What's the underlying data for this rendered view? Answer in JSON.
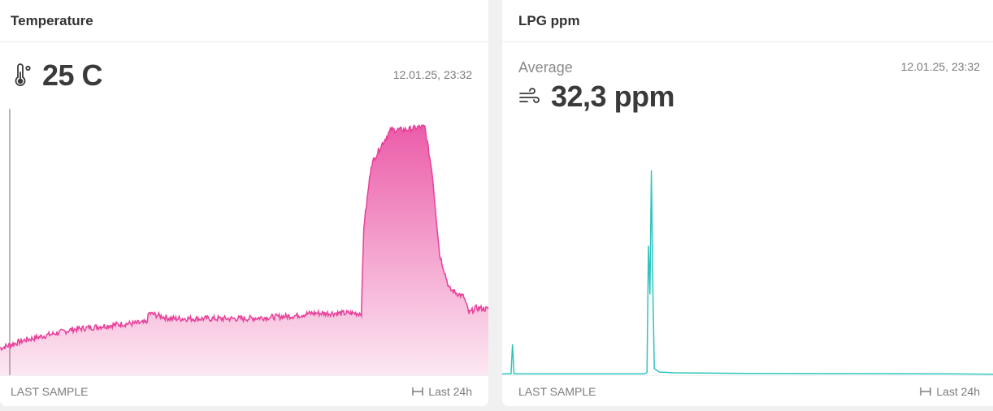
{
  "cards": [
    {
      "title": "Temperature",
      "value": "25 C",
      "icon": "thermometer-icon",
      "timestamp": "12.01.25, 23:32",
      "footer_left": "LAST SAMPLE",
      "footer_right": "Last 24h",
      "color": "#e8409a"
    },
    {
      "title": "LPG ppm",
      "subtitle": "Average",
      "value": "32,3 ppm",
      "icon": "wind-icon",
      "timestamp": "12.01.25, 23:32",
      "footer_left": "LAST SAMPLE",
      "footer_right": "Last 24h",
      "color": "#2ec4c0"
    }
  ],
  "chart_data": [
    {
      "type": "area",
      "ylim": [
        0,
        100
      ],
      "x": [
        0,
        0.05,
        0.1,
        0.15,
        0.2,
        0.25,
        0.3,
        0.305,
        0.35,
        0.4,
        0.45,
        0.5,
        0.55,
        0.6,
        0.64,
        0.65,
        0.7,
        0.74,
        0.745,
        0.76,
        0.78,
        0.8,
        0.83,
        0.86,
        0.87,
        0.885,
        0.9,
        0.92,
        0.95,
        0.96,
        0.975,
        1.0
      ],
      "values": [
        10,
        13,
        15,
        17,
        18,
        19,
        19.5,
        23,
        21,
        21,
        21,
        21,
        21.5,
        22,
        23,
        23,
        23,
        23,
        55,
        78,
        85,
        91,
        91,
        92,
        92,
        75,
        45,
        32,
        29,
        23,
        25,
        24.5
      ],
      "grid": false,
      "legend": "none"
    },
    {
      "type": "line",
      "ylim": [
        0,
        100
      ],
      "x": [
        0,
        0.018,
        0.021,
        0.024,
        0.03,
        0.1,
        0.2,
        0.29,
        0.295,
        0.298,
        0.301,
        0.304,
        0.307,
        0.31,
        0.32,
        0.35,
        0.5,
        0.7,
        0.9,
        1.0
      ],
      "values": [
        0.5,
        0.5,
        11.5,
        0.5,
        0.5,
        0.5,
        0.5,
        0.5,
        1,
        48,
        30,
        76,
        32,
        2.5,
        1.2,
        0.9,
        0.7,
        0.6,
        0.5,
        0.4
      ],
      "grid": false,
      "legend": "none"
    }
  ]
}
